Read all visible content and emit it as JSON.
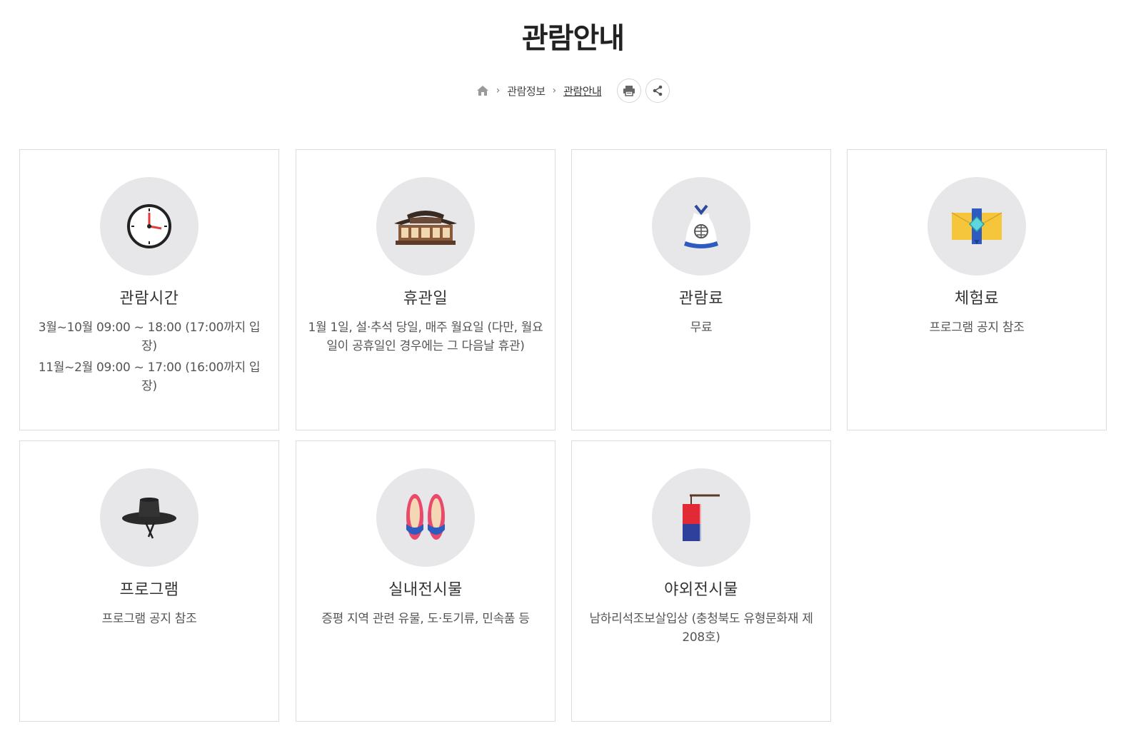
{
  "header": {
    "title": "관람안내"
  },
  "breadcrumb": {
    "home_icon": "home-icon",
    "items": [
      "관람정보",
      "관람안내"
    ],
    "actions": [
      "print-icon",
      "share-icon"
    ]
  },
  "cards": [
    {
      "icon": "clock-icon",
      "title": "관람시간",
      "lines": [
        "3월~10월 09:00 ~ 18:00 (17:00까지 입장)",
        "11월~2월 09:00 ~ 17:00 (16:00까지 입장)"
      ]
    },
    {
      "icon": "hanok-building-icon",
      "title": "휴관일",
      "lines": [
        "1월 1일, 설·추석 당일, 매주 월요일 (다만, 월요일이 공휴일인 경우에는 그 다음날 휴관)"
      ]
    },
    {
      "icon": "money-pouch-icon",
      "title": "관람료",
      "lines": [
        "무료"
      ]
    },
    {
      "icon": "envelope-icon",
      "title": "체험료",
      "lines": [
        "프로그램 공지 참조"
      ]
    },
    {
      "icon": "gat-hat-icon",
      "title": "프로그램",
      "lines": [
        "프로그램 공지 참조"
      ]
    },
    {
      "icon": "flower-shoes-icon",
      "title": "실내전시물",
      "lines": [
        "증평 지역 관련 유물, 도·토기류, 민속품 등"
      ]
    },
    {
      "icon": "banner-flag-icon",
      "title": "야외전시물",
      "lines": [
        "남하리석조보살입상 (충청북도 유형문화재 제208호)"
      ]
    }
  ]
}
